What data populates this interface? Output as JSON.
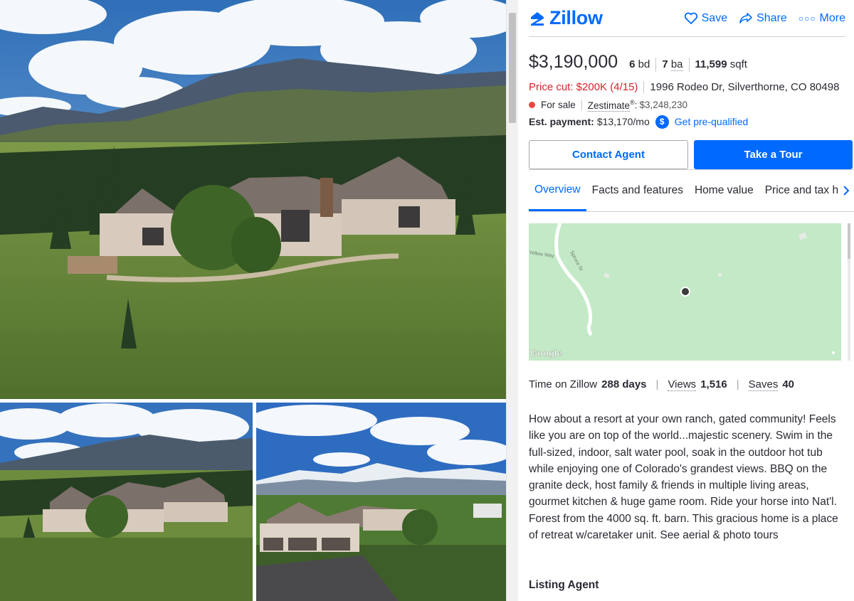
{
  "photos": {
    "main": "aerial-home-photo",
    "thumb_1": "aerial-home-photo-2",
    "thumb_2": "garage-mountain-view-photo"
  },
  "header": {
    "brand": "Zillow",
    "actions": {
      "save": "Save",
      "share": "Share",
      "more": "More"
    }
  },
  "listing": {
    "price": "$3,190,000",
    "beds": "6",
    "beds_unit": "bd",
    "baths": "7",
    "baths_unit": "ba",
    "sqft": "11,599",
    "sqft_unit": "sqft",
    "price_cut": "Price cut: $200K (4/15)",
    "address": "1996 Rodeo Dr, Silverthorne, CO 80498",
    "status": "For sale",
    "zestimate_label": "Zestimate",
    "zestimate_value": "$3,248,230",
    "payment_label": "Est. payment:",
    "payment_value": "$13,170/mo",
    "prequal_link": "Get pre-qualified"
  },
  "buttons": {
    "contact": "Contact Agent",
    "tour": "Take a Tour"
  },
  "tabs": [
    "Overview",
    "Facts and features",
    "Home value",
    "Price and tax history"
  ],
  "map": {
    "road_label_1": "Yellow Way",
    "road_label_2": "Spruce St",
    "attribution": "Google"
  },
  "stats": {
    "time_label": "Time on Zillow",
    "time_value": "288 days",
    "views_label": "Views",
    "views_value": "1,516",
    "saves_label": "Saves",
    "saves_value": "40"
  },
  "description": "How about a resort at your own ranch, gated community! Feels like you are on top of the world...majestic scenery. Swim in the full-sized, indoor, salt water pool, soak in the outdoor hot tub while enjoying one of Colorado's grandest views. BBQ on the granite deck, host family & friends in multiple living areas, gourmet kitchen & huge game room. Ride your horse into Nat'l. Forest from the 4000 sq. ft. barn. This gracious home is a place of retreat w/caretaker unit. See aerial & photo tours",
  "listing_agent_heading": "Listing Agent",
  "colors": {
    "brand": "#006aff",
    "price_cut": "#d5232b",
    "for_sale": "#e8473f",
    "map_bg": "#c3e9c6"
  }
}
